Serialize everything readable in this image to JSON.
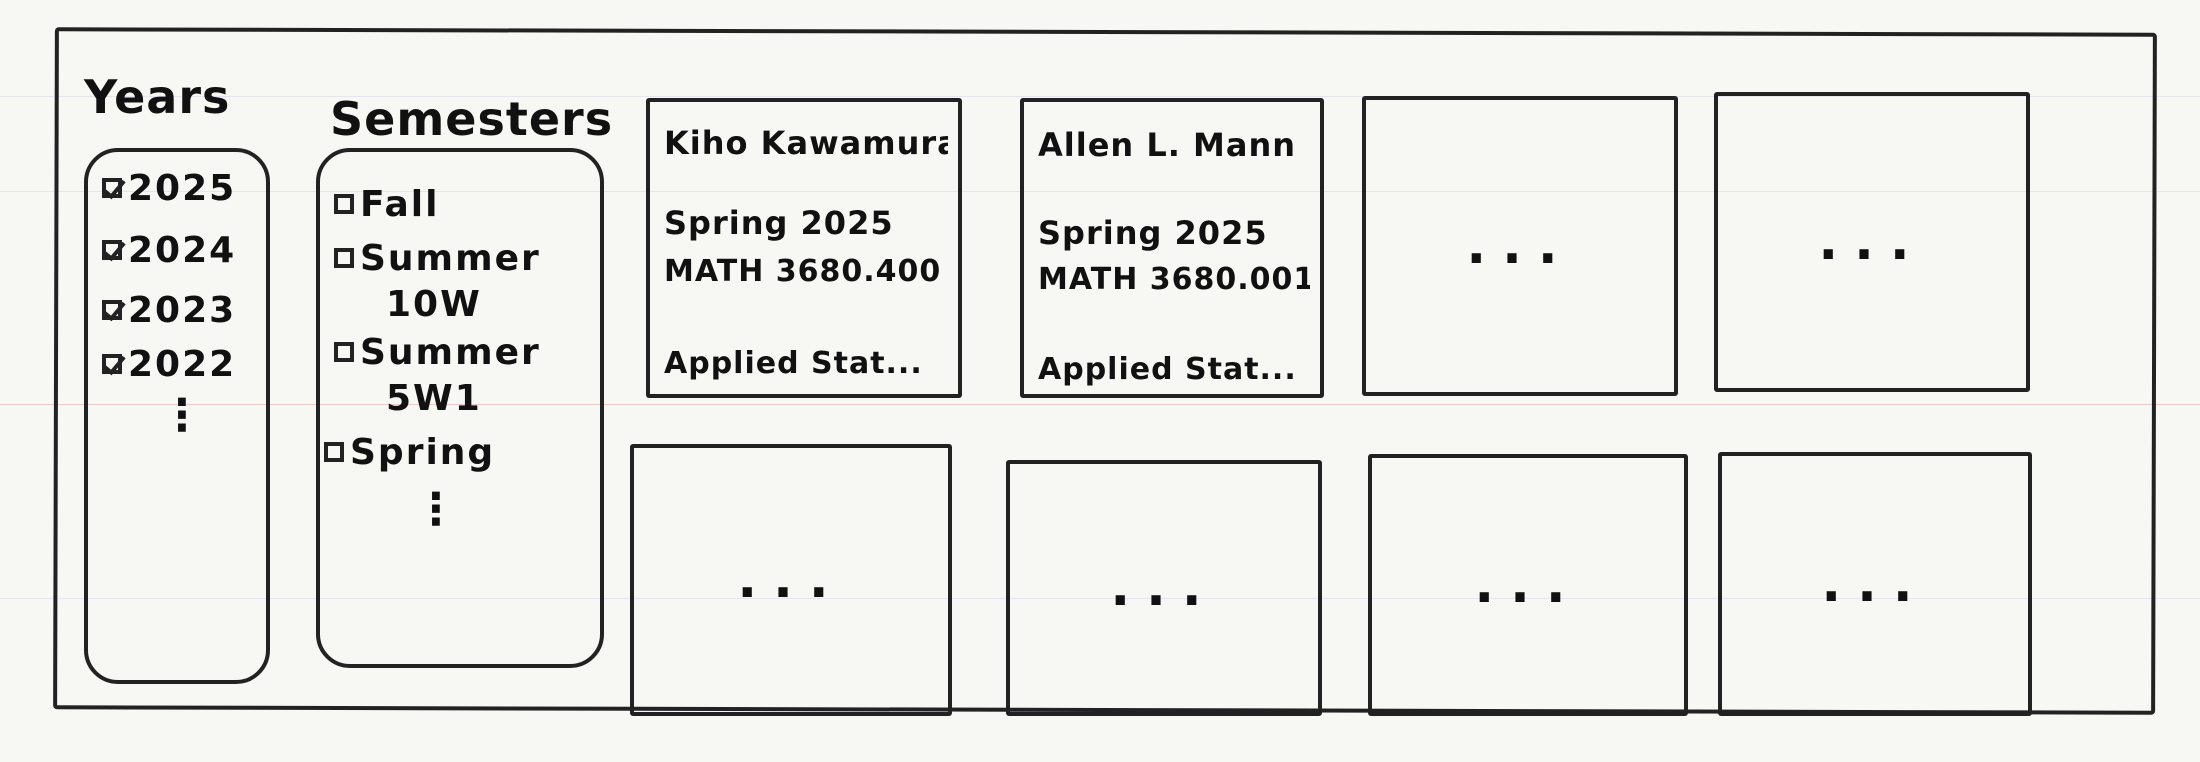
{
  "years_panel": {
    "title": "Years",
    "options": [
      {
        "label": "2025",
        "checked": true
      },
      {
        "label": "2024",
        "checked": true
      },
      {
        "label": "2023",
        "checked": true
      },
      {
        "label": "2022",
        "checked": true
      }
    ],
    "more": "⋮"
  },
  "semesters_panel": {
    "title": "Semesters",
    "options": [
      {
        "label": "Fall",
        "label2": "",
        "checked": false
      },
      {
        "label": "Summer",
        "label2": "10W",
        "checked": false
      },
      {
        "label": "Summer",
        "label2": "5W1",
        "checked": false
      },
      {
        "label": "Spring",
        "label2": "",
        "checked": false
      }
    ],
    "more": "⋮"
  },
  "cards": [
    {
      "instructor": "Kiho Kawamura",
      "term": "Spring 2025",
      "course": "MATH 3680.400",
      "title": "Applied Stat..."
    },
    {
      "instructor": "Allen L. Mann",
      "term": "Spring 2025",
      "course": "MATH 3680.001",
      "title": "Applied Stat..."
    },
    {
      "placeholder": "..."
    },
    {
      "placeholder": "..."
    },
    {
      "placeholder": "..."
    },
    {
      "placeholder": "..."
    },
    {
      "placeholder": "..."
    },
    {
      "placeholder": "..."
    }
  ]
}
